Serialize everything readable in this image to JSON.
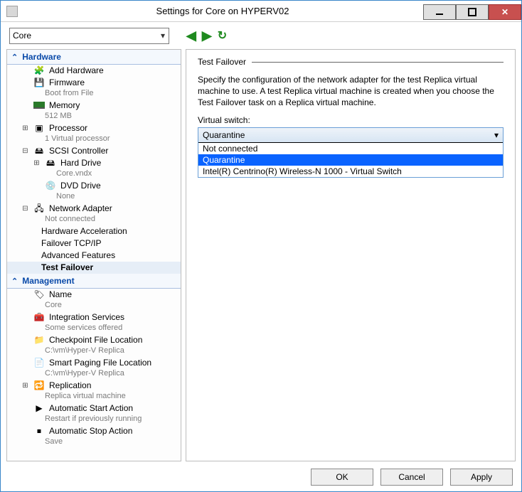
{
  "window": {
    "title": "Settings for Core on HYPERV02"
  },
  "toolbar": {
    "vm": "Core"
  },
  "sections": {
    "hardware": "Hardware",
    "management": "Management"
  },
  "tree": {
    "addHardware": {
      "label": "Add Hardware"
    },
    "firmware": {
      "label": "Firmware",
      "sub": "Boot from File"
    },
    "memory": {
      "label": "Memory",
      "sub": "512 MB"
    },
    "processor": {
      "label": "Processor",
      "sub": "1 Virtual processor"
    },
    "scsi": {
      "label": "SCSI Controller"
    },
    "hardDrive": {
      "label": "Hard Drive",
      "sub": "Core.vndx"
    },
    "dvd": {
      "label": "DVD Drive",
      "sub": "None"
    },
    "nic": {
      "label": "Network Adapter",
      "sub": "Not connected"
    },
    "hwAccel": {
      "label": "Hardware Acceleration"
    },
    "failoverTcp": {
      "label": "Failover TCP/IP"
    },
    "advFeat": {
      "label": "Advanced Features"
    },
    "testFailover": {
      "label": "Test Failover"
    },
    "name": {
      "label": "Name",
      "sub": "Core"
    },
    "integ": {
      "label": "Integration Services",
      "sub": "Some services offered"
    },
    "checkpoint": {
      "label": "Checkpoint File Location",
      "sub": "C:\\vm\\Hyper-V Replica"
    },
    "paging": {
      "label": "Smart Paging File Location",
      "sub": "C:\\vm\\Hyper-V Replica"
    },
    "replication": {
      "label": "Replication",
      "sub": "Replica virtual machine"
    },
    "autoStart": {
      "label": "Automatic Start Action",
      "sub": "Restart if previously running"
    },
    "autoStop": {
      "label": "Automatic Stop Action",
      "sub": "Save"
    }
  },
  "panel": {
    "title": "Test Failover",
    "desc": "Specify the configuration of the network adapter for the test Replica virtual machine to use. A test Replica virtual machine is created when you choose the Test Failover task on a Replica virtual machine.",
    "switchLabel": "Virtual switch:",
    "selected": "Quarantine",
    "options": [
      "Not connected",
      "Quarantine",
      "Intel(R) Centrino(R) Wireless-N 1000 - Virtual Switch"
    ]
  },
  "buttons": {
    "ok": "OK",
    "cancel": "Cancel",
    "apply": "Apply"
  }
}
